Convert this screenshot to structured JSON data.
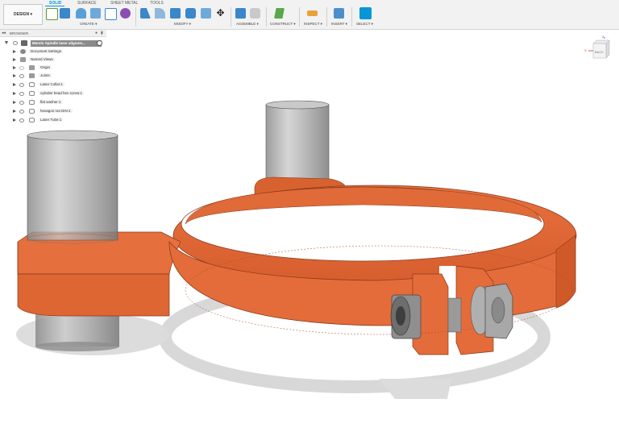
{
  "toolbar": {
    "workspace_label": "DESIGN ▾",
    "tabs": [
      "SOLID",
      "SURFACE",
      "SHEET METAL",
      "TOOLS"
    ],
    "groups": [
      "CREATE ▾",
      "MODIFY ▾",
      "ASSEMBLE ▾",
      "CONSTRUCT ▾",
      "INSPECT ▾",
      "INSERT ▾",
      "SELECT ▾"
    ]
  },
  "browser": {
    "title": "BROWSER",
    "root": "Merelo Spindle laser alignme...",
    "items": [
      {
        "label": "Document Settings",
        "icon": "gear-icon"
      },
      {
        "label": "Named Views",
        "icon": "folder-icon"
      },
      {
        "label": "Origin",
        "icon": "folder-icon"
      },
      {
        "label": "Joints",
        "icon": "folder-icon"
      },
      {
        "label": "Laser Collar:1",
        "icon": "component-icon"
      },
      {
        "label": "cylinder head hex screw:1",
        "icon": "component-icon"
      },
      {
        "label": "flat washer:1",
        "icon": "component-icon"
      },
      {
        "label": "hexagon nut DIN:1",
        "icon": "component-icon"
      },
      {
        "label": "Laser Tube:1",
        "icon": "component-icon"
      }
    ]
  },
  "viewcube": {
    "face": "BACK",
    "x_axis": "X",
    "z_axis": "Z"
  },
  "colors": {
    "accent": "#0696d7",
    "collar": "#e2693a",
    "collar_dark": "#b84c22",
    "tube": "#9a9a9a"
  }
}
